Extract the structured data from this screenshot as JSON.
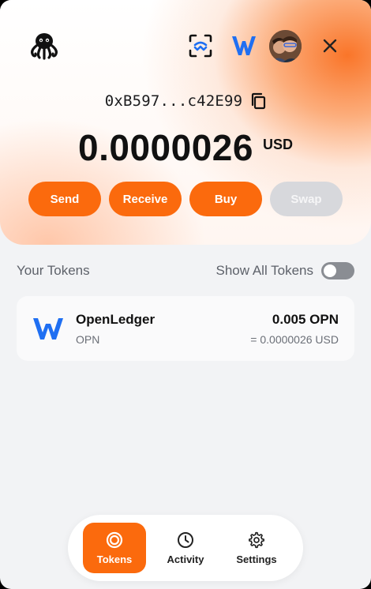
{
  "header": {
    "logo_icon": "octopus-icon",
    "scan_icon": "wallet-scan-icon",
    "w_icon": "w-logo-icon",
    "avatar_icon": "avatar",
    "close_icon": "close-icon"
  },
  "account": {
    "address": "0xB597...c42E99",
    "balance": "0.0000026",
    "currency": "USD"
  },
  "actions": {
    "send": "Send",
    "receive": "Receive",
    "buy": "Buy",
    "swap": "Swap"
  },
  "tokens": {
    "title": "Your Tokens",
    "show_all_label": "Show All Tokens",
    "show_all_enabled": false,
    "items": [
      {
        "name": "OpenLedger",
        "symbol": "OPN",
        "amount": "0.005 OPN",
        "usd_value": "= 0.0000026 USD"
      }
    ]
  },
  "nav": {
    "tokens": "Tokens",
    "activity": "Activity",
    "settings": "Settings"
  },
  "colors": {
    "accent": "#fb6a0d",
    "brand_blue": "#1f6ff2",
    "disabled": "#d7d8dc"
  }
}
